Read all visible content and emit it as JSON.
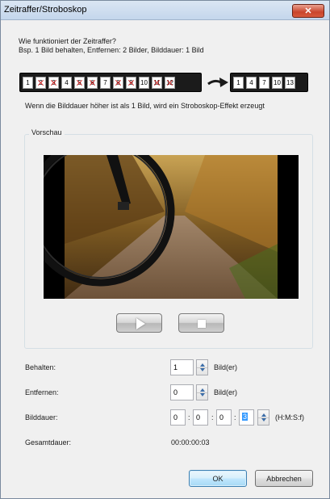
{
  "window": {
    "title": "Zeitraffer/Stroboskop",
    "close_label": "✕"
  },
  "intro": {
    "question": "Wie funktioniert der Zeitraffer?",
    "example": "Bsp. 1 Bild behalten, Entfernen: 2 Bilder, Bilddauer: 1 Bild"
  },
  "filmstrip_source": [
    {
      "label": "1",
      "removed": false
    },
    {
      "label": "2",
      "removed": true
    },
    {
      "label": "3",
      "removed": true
    },
    {
      "label": "4",
      "removed": false
    },
    {
      "label": "5",
      "removed": true
    },
    {
      "label": "6",
      "removed": true
    },
    {
      "label": "7",
      "removed": false
    },
    {
      "label": "8",
      "removed": true
    },
    {
      "label": "9",
      "removed": true
    },
    {
      "label": "10",
      "removed": false
    },
    {
      "label": "11",
      "removed": true
    },
    {
      "label": "12",
      "removed": true
    }
  ],
  "filmstrip_result": [
    "1",
    "4",
    "7",
    "10",
    "13"
  ],
  "note": "Wenn die Bilddauer höher ist als 1 Bild, wird ein Stroboskop-Effekt erzeugt",
  "preview": {
    "label": "Vorschau"
  },
  "fields": {
    "keep": {
      "label": "Behalten:",
      "value": "1",
      "unit": "Bild(er)"
    },
    "remove": {
      "label": "Entfernen:",
      "value": "0",
      "unit": "Bild(er)"
    },
    "duration": {
      "label": "Bilddauer:",
      "h": "0",
      "m": "0",
      "s": "0",
      "f": "3",
      "unit": "(H:M:S:f)"
    },
    "total": {
      "label": "Gesamtdauer:",
      "value": "00:00:00:03"
    }
  },
  "buttons": {
    "ok": "OK",
    "cancel": "Abbrechen"
  }
}
